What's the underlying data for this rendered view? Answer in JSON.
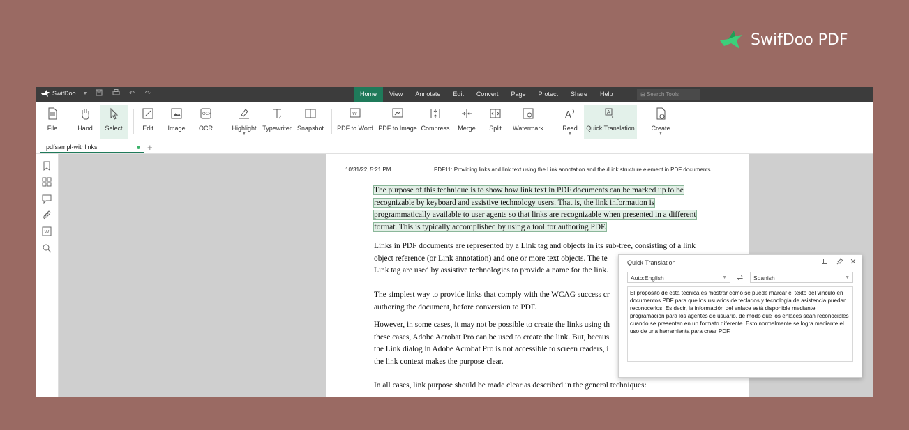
{
  "brand": {
    "name": "SwifDoo PDF"
  },
  "titlebar": {
    "app_name": "SwifDoo",
    "menu": [
      "Home",
      "View",
      "Annotate",
      "Edit",
      "Convert",
      "Page",
      "Protect",
      "Share",
      "Help"
    ],
    "active_menu": "Home",
    "search_placeholder": "Search Tools"
  },
  "ribbon": {
    "file": "File",
    "hand": "Hand",
    "select": "Select",
    "edit": "Edit",
    "image": "Image",
    "ocr": "OCR",
    "highlight": "Highlight",
    "typewriter": "Typewriter",
    "snapshot": "Snapshot",
    "pdf_to_word": "PDF to Word",
    "pdf_to_image": "PDF to Image",
    "compress": "Compress",
    "merge": "Merge",
    "split": "Split",
    "watermark": "Watermark",
    "read": "Read",
    "quick_translation": "Quick Translation",
    "create": "Create"
  },
  "tabs": {
    "doc_name": "pdfsampl-withlinks"
  },
  "document": {
    "header_date": "10/31/22, 5:21 PM",
    "header_title": "PDF11: Providing links and link text using the Link annotation and the /Link structure element in PDF documents",
    "highlighted_lines": [
      "The purpose of this technique is to show how link text in PDF documents can be marked up to be",
      "recognizable by keyboard and assistive technology users. That is, the link information is",
      "programmatically available to user agents so that links are recognizable when presented in a different",
      "format. This is typically accomplished by using a tool for authoring PDF."
    ],
    "para2": [
      "Links in PDF documents are represented by a Link tag and objects in its sub-tree, consisting of a link",
      "object reference (or Link annotation) and one or more text objects. The te",
      "Link tag are used by assistive technologies to provide a name for the link."
    ],
    "para3": [
      "The simplest way to provide links that comply with the WCAG success cr",
      "authoring the document, before conversion to PDF."
    ],
    "para4": [
      "However, in some cases, it may not be possible to create the links using th",
      "these cases, Adobe Acrobat Pro can be used to create the link. But, becaus",
      "the Link dialog in Adobe Acrobat Pro is not accessible to screen readers, i",
      "the link context makes the purpose clear."
    ],
    "para5": "In all cases, link purpose should be made clear as described in the general techniques:"
  },
  "quick_translation": {
    "title": "Quick Translation",
    "source_lang": "Auto:English",
    "target_lang": "Spanish",
    "output": "El propósito de esta técnica es mostrar cómo se puede marcar el texto del vínculo en documentos PDF para que los usuarios de teclados y tecnología de asistencia puedan reconocerlos. Es decir, la información del enlace está disponible mediante programación para los agentes de usuario, de modo que los enlaces sean reconocibles cuando se presenten en un formato diferente. Esto normalmente se logra mediante el uso de una herramienta para crear PDF."
  },
  "colors": {
    "accent": "#1f7a5a",
    "background": "#9a6a63",
    "highlight": "#e2efe6"
  }
}
